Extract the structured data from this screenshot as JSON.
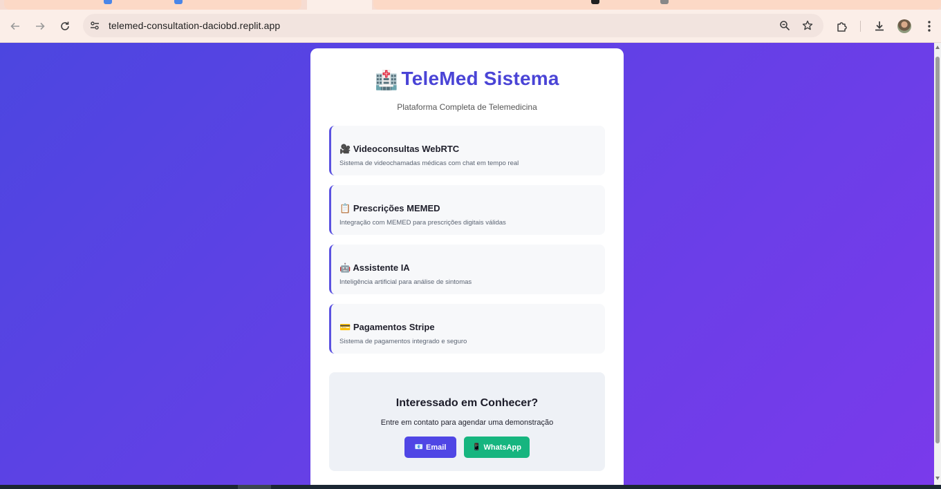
{
  "browser": {
    "url": "telemed-consultation-daciobd.replit.app"
  },
  "colors": {
    "brand": "#4a44d6",
    "gradient_start": "#4c46e0",
    "gradient_end": "#7a3aeb",
    "email_button": "#4f46e5",
    "whatsapp_button": "#16b57f"
  },
  "page": {
    "title_icon": "🏥",
    "title": "TeleMed Sistema",
    "subtitle": "Plataforma Completa de Telemedicina",
    "features": [
      {
        "icon": "🎥",
        "title": "Videoconsultas WebRTC",
        "description": "Sistema de videochamadas médicas com chat em tempo real"
      },
      {
        "icon": "📋",
        "title": "Prescrições MEMED",
        "description": "Integração com MEMED para prescrições digitais válidas"
      },
      {
        "icon": "🤖",
        "title": "Assistente IA",
        "description": "Inteligência artificial para análise de sintomas"
      },
      {
        "icon": "💳",
        "title": "Pagamentos Stripe",
        "description": "Sistema de pagamentos integrado e seguro"
      }
    ],
    "cta": {
      "title": "Interessado em Conhecer?",
      "text": "Entre em contato para agendar uma demonstração",
      "email_icon": "📧",
      "email_label": "Email",
      "whatsapp_icon": "📱",
      "whatsapp_label": "WhatsApp"
    }
  }
}
